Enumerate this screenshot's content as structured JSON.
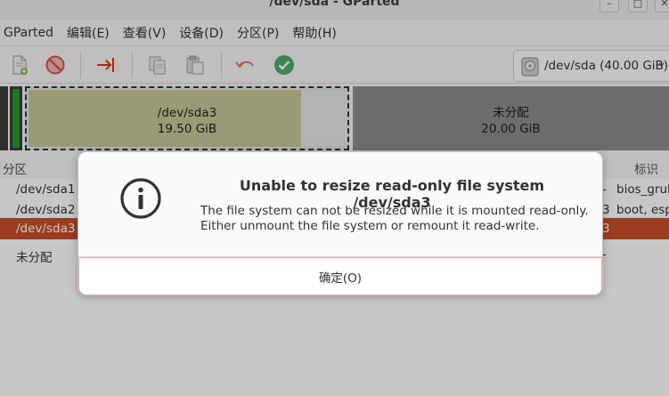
{
  "window": {
    "title": "/dev/sda - GParted",
    "minimize_glyph": "–",
    "maximize_glyph": "□",
    "close_glyph": "✕"
  },
  "menu": [
    "GParted",
    "编辑(E)",
    "查看(V)",
    "设备(D)",
    "分区(P)",
    "帮助(H)"
  ],
  "toolbar": {
    "icons": [
      "new-partition-icon",
      "delete-icon",
      "resize-move-icon",
      "copy-icon",
      "paste-icon",
      "undo-icon",
      "apply-icon"
    ],
    "device_selector": {
      "label": "/dev/sda (40.00 GiB)",
      "icon": "disk-icon",
      "chevron": "⌄"
    }
  },
  "disk_map": {
    "sda3": {
      "name": "/dev/sda3",
      "size": "19.50 GiB",
      "used_fraction": 0.86
    },
    "unallocated": {
      "name": "未分配",
      "size": "20.00 GiB"
    }
  },
  "partition_list": {
    "columns": {
      "partition": "分区",
      "flags": "标识"
    },
    "rows": [
      {
        "partition": "/dev/sda1",
        "flags_fragment": "-",
        "flags": "bios_grub"
      },
      {
        "partition": "/dev/sda2",
        "flags_fragment": "3",
        "flags": "boot, esp"
      },
      {
        "partition": "/dev/sda3",
        "flags_fragment": "3",
        "flags": ""
      },
      {
        "partition": "未分配",
        "flags_fragment": "-",
        "flags": ""
      }
    ]
  },
  "dialog": {
    "icon": "info-icon",
    "title": "Unable to resize read-only file system /dev/sda3",
    "line1": "The file system can not be resized while it is mounted read-only.",
    "line2": "Either unmount the file system or remount it read-write.",
    "ok_label": "确定(O)"
  },
  "colors": {
    "selection": "#c7502a",
    "ext4_used": "#c6c698",
    "unallocated": "#8c8c8c",
    "bios_grub_green": "#2b9a2e"
  }
}
